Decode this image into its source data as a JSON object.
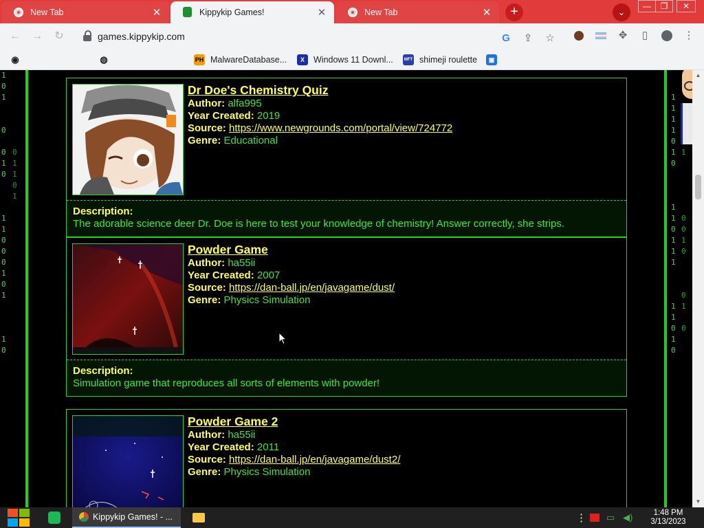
{
  "browser": {
    "tabs": [
      {
        "title": "New Tab",
        "active": false
      },
      {
        "title": "Kippykip Games!",
        "active": true
      },
      {
        "title": "New Tab",
        "active": false
      }
    ],
    "url": "games.kippykip.com",
    "bookmarks": [
      {
        "label": "",
        "icon": "bookmark-icon"
      },
      {
        "label": "",
        "icon": "globe-icon"
      },
      {
        "label": "MalwareDatabase...",
        "icon": "ph-icon",
        "badge": "PH"
      },
      {
        "label": "Windows 11 Downl...",
        "icon": "x-icon",
        "badge": "X"
      },
      {
        "label": "shimeji roulette",
        "icon": "mft-icon",
        "badge": "MFT"
      },
      {
        "label": "",
        "icon": "app-icon"
      }
    ]
  },
  "games": [
    {
      "title": "Dr Doe's Chemistry Quiz",
      "author_label": "Author:",
      "author": "alfa995",
      "year_label": "Year Created:",
      "year": "2019",
      "source_label": "Source:",
      "source": "https://www.newgrounds.com/portal/view/724772",
      "genre_label": "Genre:",
      "genre": "Educational",
      "desc_label": "Description:",
      "description": "The adorable science deer Dr. Doe is here to test your knowledge of chemistry! Answer correctly, she strips."
    },
    {
      "title": "Powder Game",
      "author_label": "Author:",
      "author": "ha55ii",
      "year_label": "Year Created:",
      "year": "2007",
      "source_label": "Source:",
      "source": "https://dan-ball.jp/en/javagame/dust/",
      "genre_label": "Genre:",
      "genre": "Physics Simulation",
      "desc_label": "Description:",
      "description": "Simulation game that reproduces all sorts of elements with powder!"
    },
    {
      "title": "Powder Game 2",
      "author_label": "Author:",
      "author": "ha55ii",
      "year_label": "Year Created:",
      "year": "2011",
      "source_label": "Source:",
      "source": "https://dan-ball.jp/en/javagame/dust2/",
      "genre_label": "Genre:",
      "genre": "Physics Simulation"
    }
  ],
  "taskbar": {
    "window_title": "Kippykip Games! - ...",
    "time": "1:48 PM",
    "date": "3/13/2023"
  },
  "colors": {
    "tab_strip": "#e23b3b",
    "page_text": "#39e739",
    "accent_yellow": "#ffff57",
    "border_green": "#2bcf2b"
  }
}
